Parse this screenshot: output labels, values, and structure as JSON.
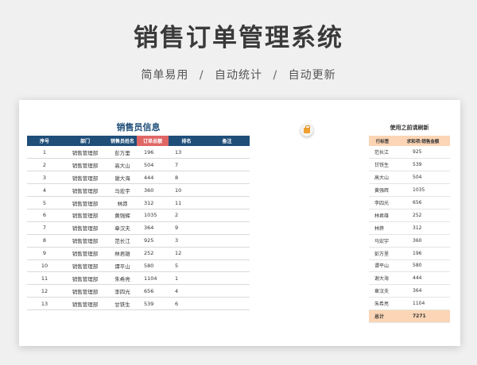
{
  "header": {
    "title": "销售订单管理系统",
    "subtitle_parts": [
      "简单易用",
      "自动统计",
      "自动更新"
    ],
    "separator": "/"
  },
  "salesperson_table": {
    "title": "销售员信息",
    "columns": [
      "序号",
      "部门",
      "销售员姓名",
      "订单总额",
      "排名",
      "备注"
    ],
    "rows": [
      [
        "1",
        "销售管理部",
        "彭万里",
        "196",
        "13",
        ""
      ],
      [
        "2",
        "销售管理部",
        "高大山",
        "504",
        "7",
        ""
      ],
      [
        "3",
        "销售管理部",
        "谢大海",
        "444",
        "8",
        ""
      ],
      [
        "4",
        "销售管理部",
        "马宏宇",
        "360",
        "10",
        ""
      ],
      [
        "5",
        "销售管理部",
        "林莽",
        "312",
        "11",
        ""
      ],
      [
        "6",
        "销售管理部",
        "黄强辉",
        "1035",
        "2",
        ""
      ],
      [
        "7",
        "销售管理部",
        "章汉夫",
        "364",
        "9",
        ""
      ],
      [
        "8",
        "销售管理部",
        "范长江",
        "925",
        "3",
        ""
      ],
      [
        "9",
        "销售管理部",
        "林君雄",
        "252",
        "12",
        ""
      ],
      [
        "10",
        "销售管理部",
        "谭平山",
        "580",
        "5",
        ""
      ],
      [
        "11",
        "销售管理部",
        "朱希亮",
        "1104",
        "1",
        ""
      ],
      [
        "12",
        "销售管理部",
        "李四光",
        "656",
        "4",
        ""
      ],
      [
        "13",
        "销售管理部",
        "甘铁生",
        "539",
        "6",
        ""
      ]
    ]
  },
  "pivot": {
    "title": "使用之前请刷新",
    "columns": [
      "行标签",
      "求和项:销售金额"
    ],
    "rows": [
      [
        "范长江",
        "925"
      ],
      [
        "甘铁生",
        "539"
      ],
      [
        "高大山",
        "504"
      ],
      [
        "黄强辉",
        "1035"
      ],
      [
        "李四光",
        "656"
      ],
      [
        "林君雄",
        "252"
      ],
      [
        "林莽",
        "312"
      ],
      [
        "马宏宇",
        "360"
      ],
      [
        "彭万里",
        "196"
      ],
      [
        "谭平山",
        "580"
      ],
      [
        "谢大海",
        "444"
      ],
      [
        "章汉夫",
        "364"
      ],
      [
        "朱希亮",
        "1104"
      ]
    ],
    "total_label": "总计",
    "total_value": "7271"
  },
  "refresh_button": {
    "icon": "lock-icon",
    "color": "#f0a030"
  }
}
